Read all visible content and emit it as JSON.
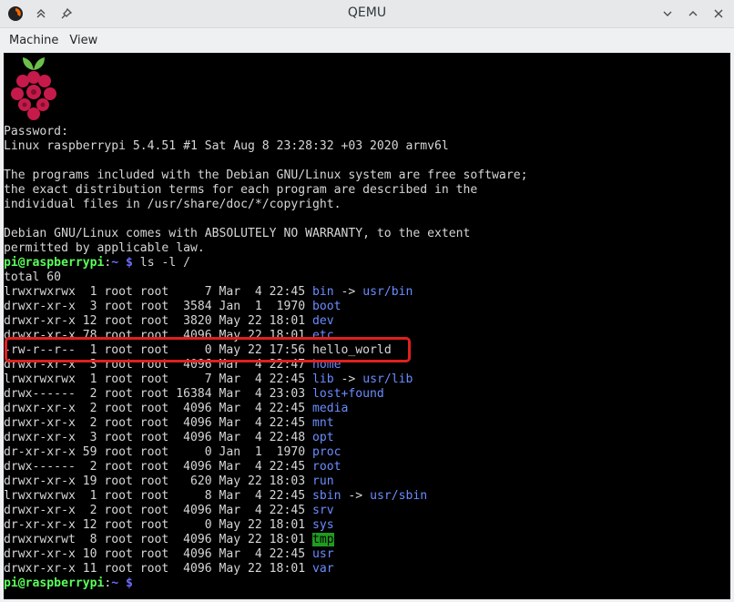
{
  "window": {
    "title": "QEMU",
    "menu": [
      "Machine",
      "View"
    ]
  },
  "terminal": {
    "banner": [
      "Password:",
      "Linux raspberrypi 5.4.51 #1 Sat Aug 8 23:28:32 +03 2020 armv6l",
      "",
      "The programs included with the Debian GNU/Linux system are free software;",
      "the exact distribution terms for each program are described in the",
      "individual files in /usr/share/doc/*/copyright.",
      "",
      "Debian GNU/Linux comes with ABSOLUTELY NO WARRANTY, to the extent",
      "permitted by applicable law."
    ],
    "prompt": {
      "user": "pi@raspberrypi",
      "sep": ":",
      "path": "~ $"
    },
    "command": " ls -l /",
    "total": "total 60",
    "entries": [
      {
        "meta": "lrwxrwxrwx  1 root root     7 Mar  4 22:45 ",
        "name": "bin",
        "kind": "dir",
        "arrow": " -> ",
        "target": "usr/bin"
      },
      {
        "meta": "drwxr-xr-x  3 root root  3584 Jan  1  1970 ",
        "name": "boot",
        "kind": "dir"
      },
      {
        "meta": "drwxr-xr-x 12 root root  3820 May 22 18:01 ",
        "name": "dev",
        "kind": "dir"
      },
      {
        "meta": "drwxr-xr-x 78 root root  4096 May 22 18:01 ",
        "name": "etc",
        "kind": "dir"
      },
      {
        "meta": "-rw-r--r--  1 root root     0 May 22 17:56 ",
        "name": "hello_world",
        "kind": "file"
      },
      {
        "meta": "drwxr-xr-x  3 root root  4096 Mar  4 22:47 ",
        "name": "home",
        "kind": "dir"
      },
      {
        "meta": "lrwxrwxrwx  1 root root     7 Mar  4 22:45 ",
        "name": "lib",
        "kind": "dir",
        "arrow": " -> ",
        "target": "usr/lib"
      },
      {
        "meta": "drwx------  2 root root 16384 Mar  4 23:03 ",
        "name": "lost+found",
        "kind": "dir"
      },
      {
        "meta": "drwxr-xr-x  2 root root  4096 Mar  4 22:45 ",
        "name": "media",
        "kind": "dir"
      },
      {
        "meta": "drwxr-xr-x  2 root root  4096 Mar  4 22:45 ",
        "name": "mnt",
        "kind": "dir"
      },
      {
        "meta": "drwxr-xr-x  3 root root  4096 Mar  4 22:48 ",
        "name": "opt",
        "kind": "dir"
      },
      {
        "meta": "dr-xr-xr-x 59 root root     0 Jan  1  1970 ",
        "name": "proc",
        "kind": "dir"
      },
      {
        "meta": "drwx------  2 root root  4096 Mar  4 22:45 ",
        "name": "root",
        "kind": "dir"
      },
      {
        "meta": "drwxr-xr-x 19 root root   620 May 22 18:03 ",
        "name": "run",
        "kind": "dir"
      },
      {
        "meta": "lrwxrwxrwx  1 root root     8 Mar  4 22:45 ",
        "name": "sbin",
        "kind": "dir",
        "arrow": " -> ",
        "target": "usr/sbin"
      },
      {
        "meta": "drwxr-xr-x  2 root root  4096 Mar  4 22:45 ",
        "name": "srv",
        "kind": "dir"
      },
      {
        "meta": "dr-xr-xr-x 12 root root     0 May 22 18:01 ",
        "name": "sys",
        "kind": "dir"
      },
      {
        "meta": "drwxrwxrwt  8 root root  4096 May 22 18:01 ",
        "name": "tmp",
        "kind": "tmp"
      },
      {
        "meta": "drwxr-xr-x 10 root root  4096 Mar  4 22:45 ",
        "name": "usr",
        "kind": "dir"
      },
      {
        "meta": "drwxr-xr-x 11 root root  4096 May 22 18:01 ",
        "name": "var",
        "kind": "dir"
      }
    ]
  },
  "colors": {
    "prompt_user": "#5aff5a",
    "prompt_path": "#6d6dff",
    "directory": "#6b8cff",
    "symlink": "#3fd8d8",
    "sticky_dir_bg": "#1f9c1f",
    "highlight_box": "#e0201e"
  }
}
